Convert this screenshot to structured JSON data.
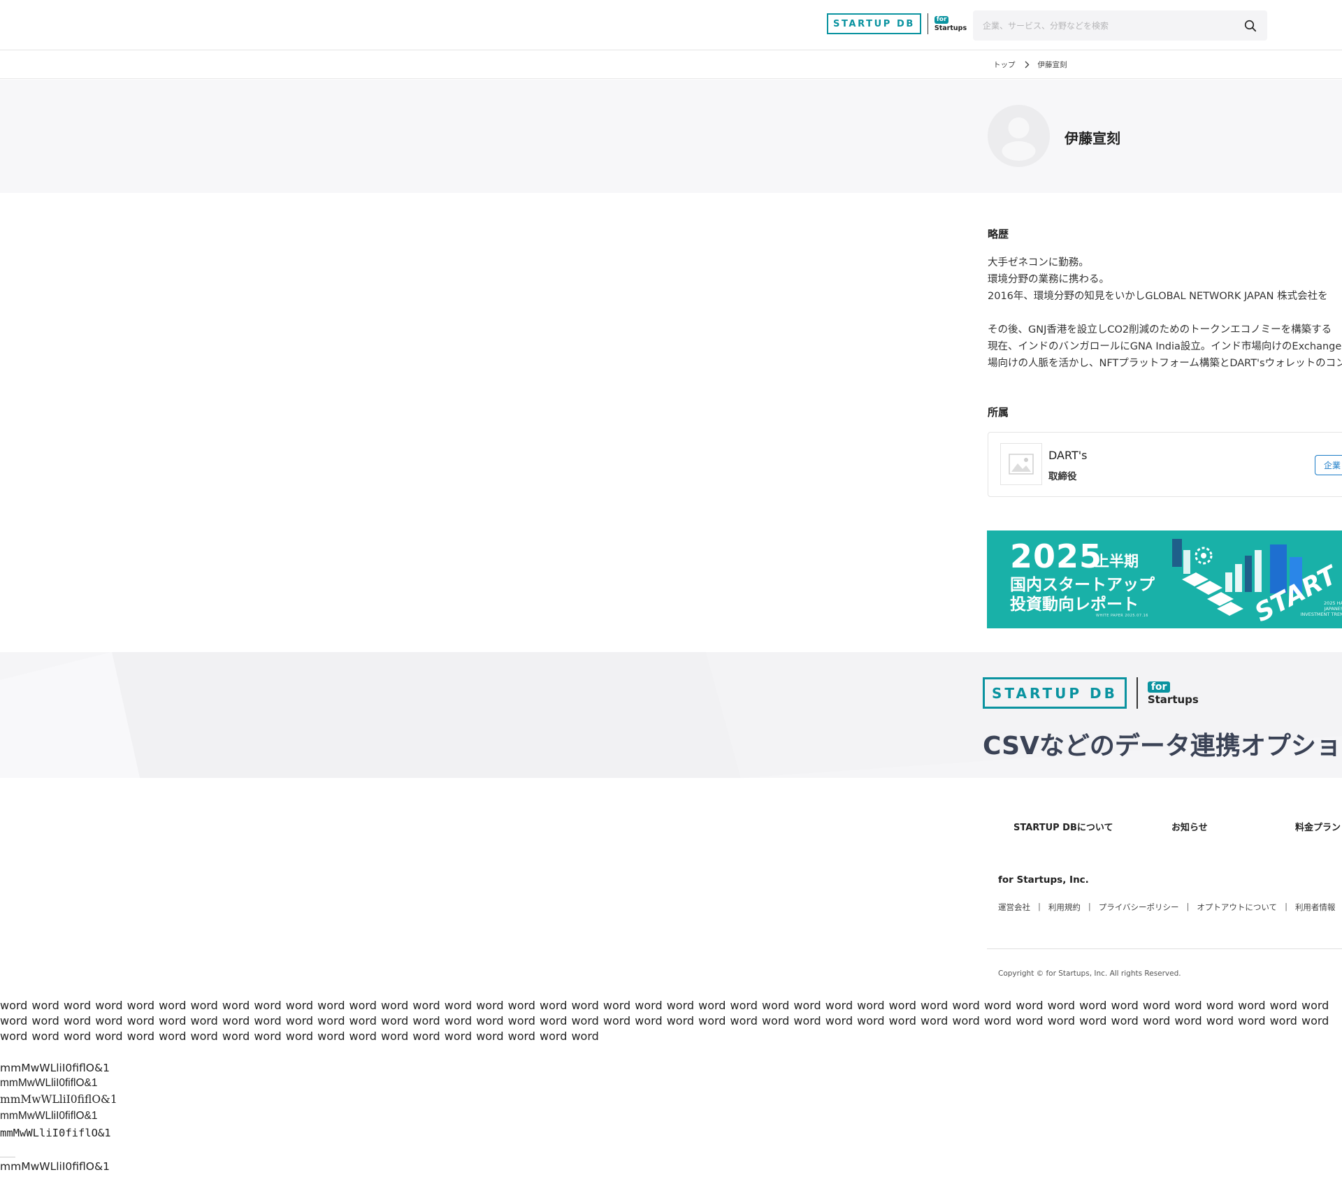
{
  "header": {
    "logo_text": "STARTUP DB",
    "logo_for": "for",
    "logo_startups": "Startups",
    "search_placeholder": "企業、サービス、分野などを検索"
  },
  "breadcrumb": {
    "home": "トップ",
    "current": "伊藤宣刻"
  },
  "profile": {
    "name": "伊藤宣刻"
  },
  "career": {
    "title": "略歴",
    "lines": [
      "大手ゼネコンに勤務。",
      "環境分野の業務に携わる。",
      "2016年、環境分野の知見をいかしGLOBAL NETWORK JAPAN 株式会社を",
      "",
      "その後、GNJ香港を設立しCO2削減のためのトークンエコノミーを構築する",
      "現在、インドのバンガロールにGNA India設立。インド市場向けのExchange",
      "場向けの人脈を活かし、NFTプラットフォーム構築とDART'sウォレットのコン"
    ]
  },
  "affiliation": {
    "title": "所属",
    "company": "DART's",
    "role": "取締役",
    "button_label": "企業"
  },
  "banner": {
    "year": "2025",
    "half": "上半期",
    "line1": "国内スタートアップ",
    "line2": "投資動向レポート",
    "paper_label": "WHITE PAPER  2025.07.16",
    "en_label_1": "2025 HA",
    "en_label_2": "JAPANES",
    "en_label_3": "INVESTMENT TREN",
    "art_text": "START"
  },
  "promo": {
    "logo_text": "STARTUP DB",
    "logo_for": "for",
    "logo_startups": "Startups",
    "headline": "CSVなどのデータ連携オプショ"
  },
  "footer": {
    "nav": [
      "STARTUP DBについて",
      "お知らせ",
      "料金プラン"
    ],
    "company": "for Startups, Inc.",
    "links": [
      "運営会社",
      "利用規約",
      "プライバシーポリシー",
      "オプトアウトについて",
      "利用者情報"
    ],
    "copyright": "Copyright © for Startups, Inc. All rights Reserved."
  },
  "test_text": {
    "words": "word word word word word word word word word word word word word word word word word word word word word word word word word word word word word word word word word word word word word word word word word word word word word word word word word word word word word word word word word word word word word word word word word word word word word word word word word word word word word word word word word word word word word word word word word word word word word word word word word word word word word word word",
    "glyphs": [
      "mmMwWLliI0fiflO&1",
      "mmMwWLliI0fiflO&1",
      "mmMwWLliI0fiflO&1",
      "mmMwWLliI0fiflO&1",
      "mmMwWLliI0fiflO&1",
      "mmMwWLliI0fiflO&1"
    ]
  }
}
